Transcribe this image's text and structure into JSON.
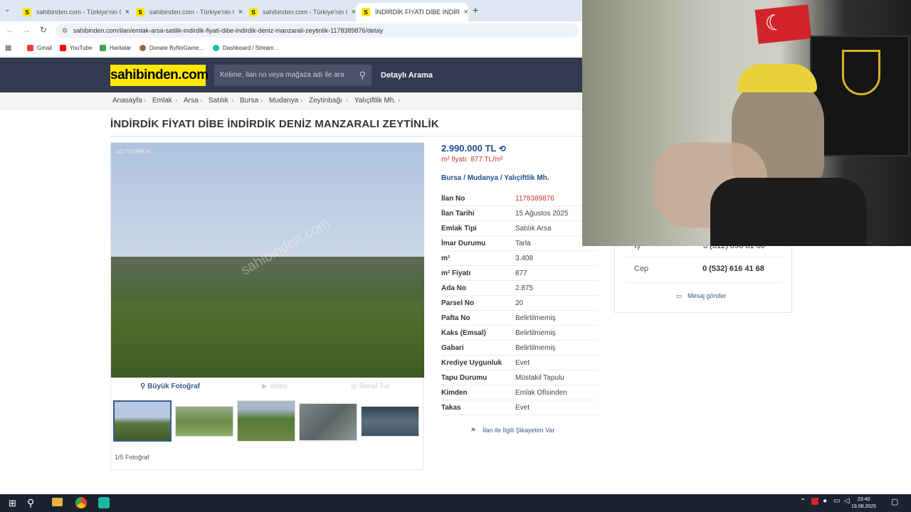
{
  "browser": {
    "tabs": [
      {
        "label": "sahibinden.com - Türkiye'nin O"
      },
      {
        "label": "sahibinden.com - Türkiye'nin O"
      },
      {
        "label": "sahibinden.com - Türkiye'nin O"
      },
      {
        "label": "İNDİRDİK FİYATI DİBE İNDİRDİK"
      }
    ],
    "favicon_letter": "S",
    "new_tab": "+",
    "url": "sahibinden.com/ilan/emlak-arsa-satilik-indirdik-fiyati-dibe-indirdik-deniz-manzarali-zeytinlik-1178389876/detay",
    "bookmarks": [
      "Gmail",
      "YouTube",
      "Haritalar",
      "Donate ByNoGame...",
      "Dashboard / Stream..."
    ]
  },
  "site": {
    "logo": "sahibinden.com",
    "search_placeholder": "Kelime, ilan no veya mağaza adı ile ara",
    "detailed_search": "Detaylı Arama",
    "breadcrumbs": [
      "Anasayfa",
      "Emlak",
      "Arsa",
      "Satılık",
      "Bursa",
      "Mudanya",
      "Zeytinbağı",
      "Yalıçiftlik Mh."
    ],
    "crumb_sep": "›"
  },
  "listing": {
    "title": "İNDİRDİK FİYATI DİBE İNDİRDİK DENİZ MANZARALI ZEYTİNLİK",
    "photo_id": "#1178389876",
    "watermark": "sahibinden.com",
    "media_buttons": {
      "big_photo": "Büyük Fotoğraf",
      "video": "Video",
      "virtual_tour": "Sanal Tur"
    },
    "photo_count": "1/5 Fotoğraf",
    "price": "2.990.000 TL",
    "m2_price": "m² fiyatı: 877 TL/m²",
    "location": [
      "Bursa",
      "Mudanya",
      "Yalıçiftlik Mh."
    ],
    "location_sep": "/",
    "details": [
      {
        "key": "İlan No",
        "value": "1178389876"
      },
      {
        "key": "İlan Tarihi",
        "value": "15 Ağustos 2025"
      },
      {
        "key": "Emlak Tipi",
        "value": "Satılık Arsa"
      },
      {
        "key": "İmar Durumu",
        "value": "Tarla"
      },
      {
        "key": "m²",
        "value": "3.408"
      },
      {
        "key": "m² Fiyatı",
        "value": "877"
      },
      {
        "key": "Ada No",
        "value": "2.875"
      },
      {
        "key": "Parsel No",
        "value": "20"
      },
      {
        "key": "Pafta No",
        "value": "Belirtilmemiş"
      },
      {
        "key": "Kaks (Emsal)",
        "value": "Belirtilmemiş"
      },
      {
        "key": "Gabari",
        "value": "Belirtilmemiş"
      },
      {
        "key": "Krediye Uygunluk",
        "value": "Evet"
      },
      {
        "key": "Tapu Durumu",
        "value": "Müstakil Tapulu"
      },
      {
        "key": "Kimden",
        "value": "Emlak Ofisinden"
      },
      {
        "key": "Takas",
        "value": "Evet"
      }
    ],
    "complaint": "İlan ile İlgili Şikayetim Var"
  },
  "contact": {
    "partial_label": "İş",
    "partial_phone": "0 (312) 090 01 00",
    "cep_label": "Cep",
    "cep_phone": "0 (532) 616 41 68",
    "message": "Mesaj gönder"
  },
  "taskbar": {
    "time": "23:40",
    "date": "19.08.2025"
  },
  "colors": {
    "brand_yellow": "#ffe800",
    "header_navy": "#343a4f",
    "link_blue": "#1f4d8f",
    "accent_red": "#c0392b"
  }
}
